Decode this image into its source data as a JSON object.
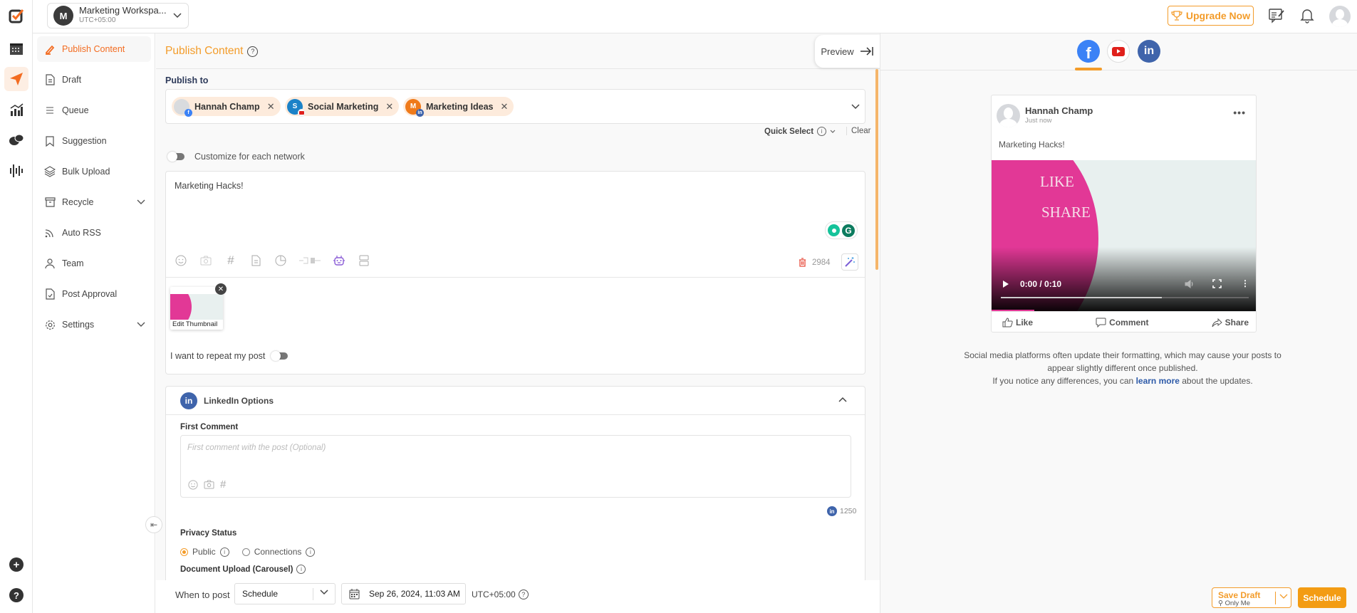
{
  "workspace": {
    "initial": "M",
    "name": "Marketing Workspa...",
    "timezone": "UTC+05:00"
  },
  "topbar": {
    "upgrade_label": "Upgrade Now"
  },
  "rail": {
    "items": [
      "logo",
      "calendar",
      "publish",
      "analytics",
      "inbox",
      "listening"
    ],
    "bottom": [
      "add",
      "help"
    ]
  },
  "nav": {
    "items": [
      {
        "label": "Publish Content",
        "icon": "pencil-icon",
        "active": true
      },
      {
        "label": "Draft",
        "icon": "document-icon"
      },
      {
        "label": "Queue",
        "icon": "list-icon"
      },
      {
        "label": "Suggestion",
        "icon": "bookmark-icon"
      },
      {
        "label": "Bulk Upload",
        "icon": "layers-icon"
      },
      {
        "label": "Recycle",
        "icon": "archive-icon",
        "expandable": true
      },
      {
        "label": "Auto RSS",
        "icon": "rss-icon"
      },
      {
        "label": "Team",
        "icon": "user-icon"
      },
      {
        "label": "Post Approval",
        "icon": "approval-icon"
      },
      {
        "label": "Settings",
        "icon": "gear-icon",
        "expandable": true
      }
    ]
  },
  "main": {
    "title": "Publish Content",
    "preview_label": "Preview",
    "publish_to_label": "Publish to",
    "accounts": [
      {
        "name": "Hannah Champ",
        "network": "facebook",
        "initial": ""
      },
      {
        "name": "Social Marketing",
        "network": "youtube",
        "initial": "S"
      },
      {
        "name": "Marketing Ideas",
        "network": "linkedin",
        "initial": "M"
      }
    ],
    "quick_select_label": "Quick Select",
    "clear_label": "Clear",
    "customize_label": "Customize for each network",
    "post_text": "Marketing Hacks!",
    "char_count": "2984",
    "thumbnail_caption": "Edit Thumbnail",
    "repeat_label": "I want to repeat my post",
    "linkedin": {
      "title": "LinkedIn Options",
      "first_comment_label": "First Comment",
      "first_comment_placeholder": "First comment with the post (Optional)",
      "char_count": "1250",
      "privacy_label": "Privacy Status",
      "privacy_options": [
        {
          "label": "Public",
          "selected": true
        },
        {
          "label": "Connections",
          "selected": false
        }
      ],
      "document_label": "Document Upload (Carousel)"
    }
  },
  "footer": {
    "when_label": "When to post",
    "schedule_option": "Schedule",
    "datetime": "Sep 26, 2024, 11:03 AM",
    "timezone": "UTC+05:00",
    "save_draft_label": "Save Draft",
    "visibility_label": "Only Me",
    "schedule_label": "Schedule"
  },
  "preview": {
    "tabs": [
      {
        "network": "facebook",
        "active": true
      },
      {
        "network": "youtube"
      },
      {
        "network": "linkedin"
      }
    ],
    "card": {
      "name": "Hannah Champ",
      "time": "Just now",
      "text": "Marketing Hacks!",
      "video_word1": "LIKE",
      "video_word2": "SHARE",
      "video_time": "0:00 / 0:10",
      "video_progress_fraction": 0.65,
      "actions": [
        "Like",
        "Comment",
        "Share"
      ]
    },
    "note_line1": "Social media platforms often update their formatting, which may cause your posts to appear slightly different once published.",
    "note_line2_pre": "If you notice any differences, you can ",
    "note_link": "learn more",
    "note_line2_post": " about the updates."
  },
  "colors": {
    "accent": "#f39c2a",
    "active_nav": "#f36c21",
    "facebook": "#3b82f6",
    "youtube": "#e0201b",
    "linkedin": "#3f64ab",
    "video_pink": "#e23896"
  }
}
